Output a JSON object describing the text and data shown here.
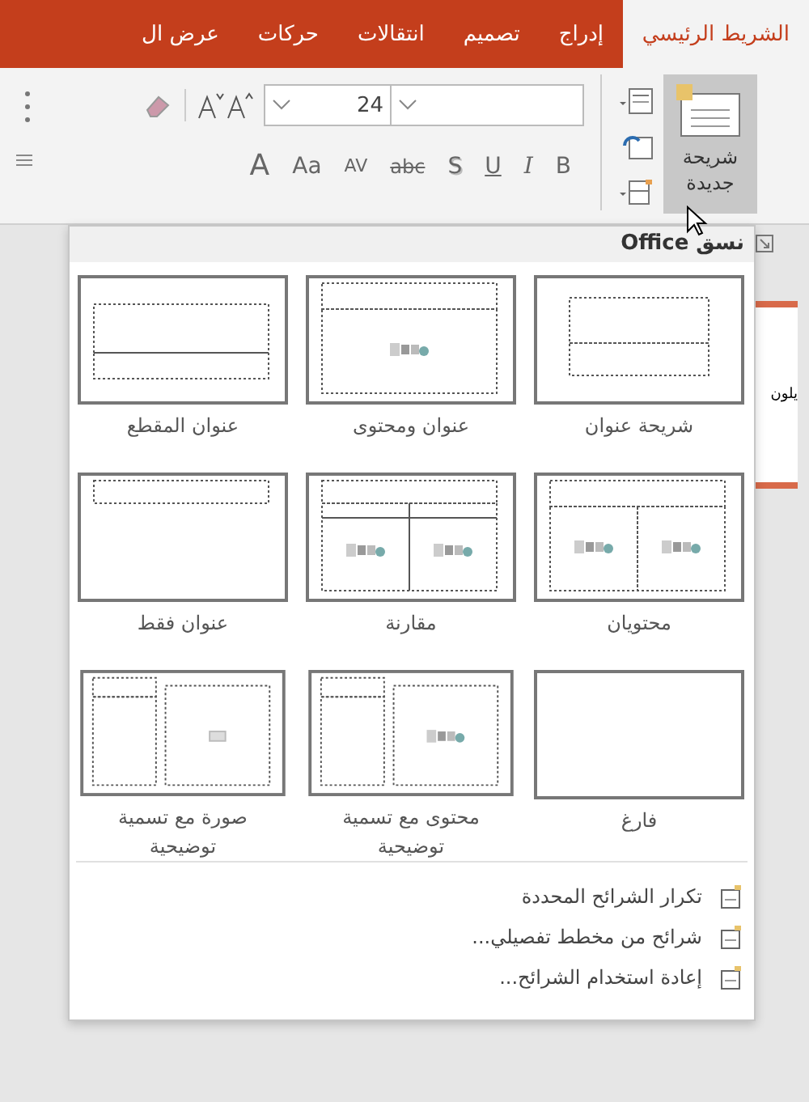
{
  "tabs": [
    {
      "label": "الشريط الرئيسي",
      "selected": true
    },
    {
      "label": "إدراج",
      "selected": false
    },
    {
      "label": "تصميم",
      "selected": false
    },
    {
      "label": "انتقالات",
      "selected": false
    },
    {
      "label": "حركات",
      "selected": false
    },
    {
      "label": "عرض ال",
      "selected": false
    }
  ],
  "ribbon": {
    "new_slide": {
      "label": "شريحة جديدة",
      "expanded": true
    },
    "font_size": "24",
    "format_buttons": [
      "B",
      "I",
      "U",
      "S",
      "abc",
      "AV",
      "Aa",
      "A"
    ]
  },
  "layout_menu": {
    "title": "نسق Office",
    "layouts": [
      {
        "label": "شريحة عنوان",
        "kind": "title"
      },
      {
        "label": "عنوان ومحتوى",
        "kind": "title-content"
      },
      {
        "label": "عنوان المقطع",
        "kind": "section-header"
      },
      {
        "label": "محتويان",
        "kind": "two-content"
      },
      {
        "label": "مقارنة",
        "kind": "comparison"
      },
      {
        "label": "عنوان فقط",
        "kind": "title-only"
      },
      {
        "label": "فارغ",
        "kind": "blank"
      },
      {
        "label": "محتوى مع تسمية توضيحية",
        "kind": "content-caption"
      },
      {
        "label": "صورة مع تسمية توضيحية",
        "kind": "picture-caption"
      }
    ],
    "commands": [
      "تكرار الشرائح المحددة",
      "شرائح من مخطط تفصيلي...",
      "إعادة استخدام الشرائح..."
    ]
  },
  "slide_thumbnail": {
    "text": "يلون"
  }
}
